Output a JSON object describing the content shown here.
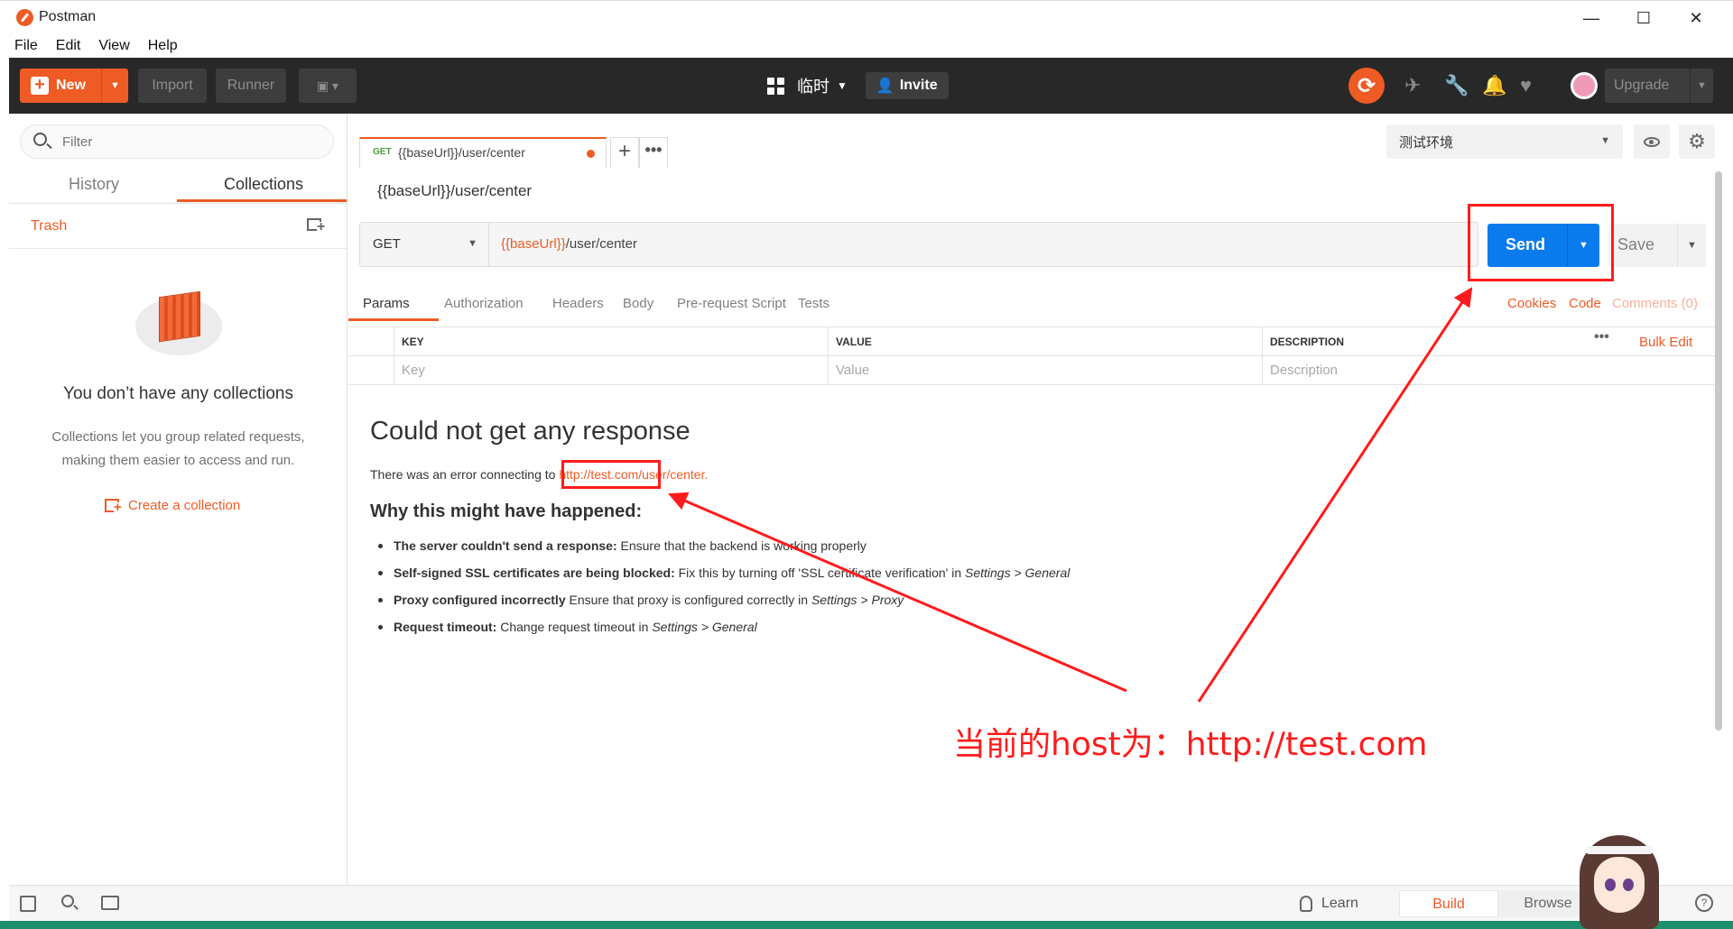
{
  "window": {
    "title": "Postman",
    "minimize": "—",
    "maximize": "☐",
    "close": "✕"
  },
  "menu": [
    "File",
    "Edit",
    "View",
    "Help"
  ],
  "toolbar": {
    "new_label": "New",
    "import_label": "Import",
    "runner_label": "Runner",
    "workspace_name": "临时",
    "invite_label": "Invite",
    "upgrade_label": "Upgrade",
    "icons": [
      "sync-icon",
      "satellite-icon",
      "wrench-icon",
      "bell-icon",
      "heart-icon",
      "avatar"
    ]
  },
  "sidebar": {
    "filter_placeholder": "Filter",
    "tabs": [
      "History",
      "Collections"
    ],
    "active_tab": "Collections",
    "trash_label": "Trash",
    "empty_title": "You don’t have any collections",
    "empty_desc_line1": "Collections let you group related requests,",
    "empty_desc_line2": "making them easier to access and run.",
    "create_collection": "Create a collection"
  },
  "request_tab": {
    "method": "GET",
    "url": "{{baseUrl}}/user/center",
    "add": "+",
    "more": "•••"
  },
  "environment": {
    "selected": "测试环境"
  },
  "request": {
    "breadcrumb": "{{baseUrl}}/user/center",
    "method": "GET",
    "url_var": "{{baseUrl}}",
    "url_path": "/user/center",
    "send_label": "Send",
    "save_label": "Save"
  },
  "request_tabs": [
    "Params",
    "Authorization",
    "Headers",
    "Body",
    "Pre-request Script",
    "Tests"
  ],
  "right_links": {
    "cookies": "Cookies",
    "code": "Code",
    "comments": "Comments (0)"
  },
  "params": {
    "headers": [
      "KEY",
      "VALUE",
      "DESCRIPTION"
    ],
    "placeholders": [
      "Key",
      "Value",
      "Description"
    ],
    "more": "•••",
    "bulk_edit": "Bulk Edit"
  },
  "response": {
    "title": "Could not get any response",
    "error_prefix": "There was an error connecting to ",
    "error_url": "http://test.com/user/center.",
    "why_title": "Why this might have happened:",
    "reasons": [
      {
        "bold": "The server couldn't send a response:",
        "text": " Ensure that the backend is working properly",
        "suffix": ""
      },
      {
        "bold": "Self-signed SSL certificates are being blocked:",
        "text": " Fix this by turning off 'SSL certificate verification' in ",
        "suffix": "Settings > General"
      },
      {
        "bold": "Proxy configured incorrectly",
        "text": " Ensure that proxy is configured correctly in ",
        "suffix": "Settings > Proxy"
      },
      {
        "bold": "Request timeout:",
        "text": " Change request timeout in ",
        "suffix": "Settings > General"
      }
    ]
  },
  "footer": {
    "learn": "Learn",
    "build": "Build",
    "browse": "Browse",
    "help": "?"
  },
  "annotation": {
    "text": "当前的host为：http://test.com",
    "color": "#ff1b1b"
  },
  "colors": {
    "accent": "#ef5b25",
    "send": "#097bed",
    "toolbar": "#282828"
  }
}
